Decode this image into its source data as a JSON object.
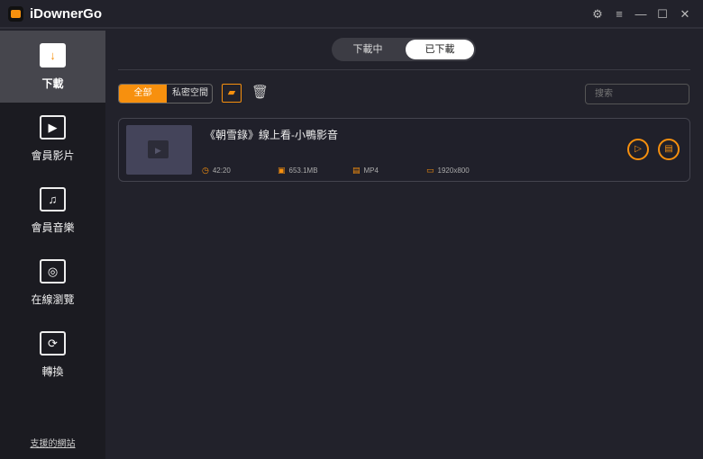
{
  "app": {
    "title": "iDownerGo"
  },
  "window_controls": [
    "settings-icon",
    "menu-icon",
    "minimize-icon",
    "maximize-icon",
    "close-icon"
  ],
  "sidebar": {
    "items": [
      {
        "label": "下載",
        "icon": "download-icon"
      },
      {
        "label": "會員影片",
        "icon": "play-icon"
      },
      {
        "label": "會員音樂",
        "icon": "music-icon"
      },
      {
        "label": "在線瀏覽",
        "icon": "globe-icon"
      },
      {
        "label": "轉換",
        "icon": "convert-icon"
      }
    ],
    "footer_link": "支援的網站"
  },
  "tabs": {
    "downloading": "下載中",
    "downloaded": "已下載"
  },
  "filter": {
    "all": "全部",
    "private": "私密空間"
  },
  "search": {
    "placeholder": "搜索"
  },
  "items": [
    {
      "title": "《朝雪錄》線上看-小鴨影音",
      "duration": "42:20",
      "size": "653.1MB",
      "format": "MP4",
      "resolution": "1920x800"
    }
  ],
  "colors": {
    "accent": "#f7900e",
    "background": "#22222b",
    "sidebar": "#1b1b21"
  }
}
